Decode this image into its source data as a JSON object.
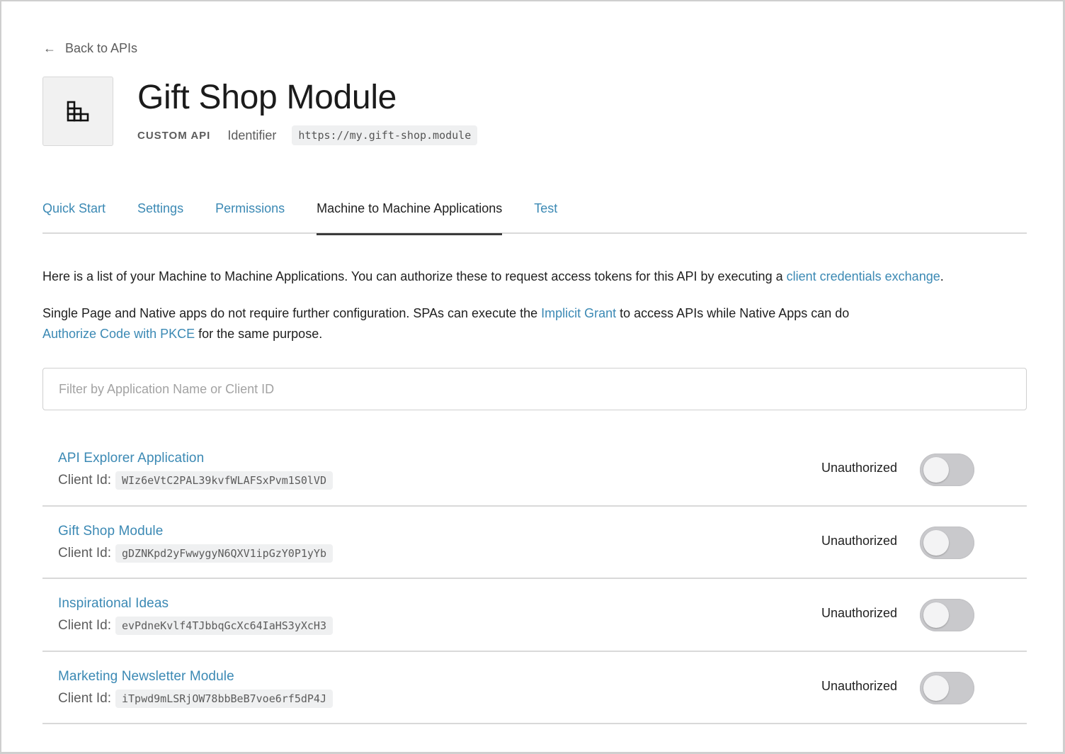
{
  "nav": {
    "back_label": "Back to APIs",
    "back_icon": "arrow-left-icon"
  },
  "header": {
    "logo_icon": "api-blocks-icon",
    "title": "Gift Shop Module",
    "type_label": "CUSTOM API",
    "identifier_label": "Identifier",
    "identifier_value": "https://my.gift-shop.module"
  },
  "tabs": [
    {
      "label": "Quick Start",
      "active": false
    },
    {
      "label": "Settings",
      "active": false
    },
    {
      "label": "Permissions",
      "active": false
    },
    {
      "label": "Machine to Machine Applications",
      "active": true
    },
    {
      "label": "Test",
      "active": false
    }
  ],
  "description": {
    "p1_text": "Here is a list of your Machine to Machine Applications. You can authorize these to request access tokens for this API by executing a ",
    "p1_link": "client credentials exchange",
    "p1_end": ".",
    "p2_text": "Single Page and Native apps do not require further configuration. SPAs can execute the ",
    "p2_link1": "Implicit Grant",
    "p2_mid": " to access APIs while Native Apps can do ",
    "p2_link2": "Authorize Code with PKCE",
    "p2_end": " for the same purpose."
  },
  "filter": {
    "placeholder": "Filter by Application Name or Client ID",
    "value": ""
  },
  "applications": [
    {
      "name": "API Explorer Application",
      "client_label": "Client Id:",
      "client_id": "WIz6eVtC2PAL39kvfWLAFSxPvm1S0lVD",
      "status": "Unauthorized",
      "authorized": false
    },
    {
      "name": "Gift Shop Module",
      "client_label": "Client Id:",
      "client_id": "gDZNKpd2yFwwygyN6QXV1ipGzY0P1yYb",
      "status": "Unauthorized",
      "authorized": false
    },
    {
      "name": "Inspirational Ideas",
      "client_label": "Client Id:",
      "client_id": "evPdneKvlf4TJbbqGcXc64IaHS3yXcH3",
      "status": "Unauthorized",
      "authorized": false
    },
    {
      "name": "Marketing Newsletter Module",
      "client_label": "Client Id:",
      "client_id": "iTpwd9mLSRjOW78bbBeB7voe6rf5dP4J",
      "status": "Unauthorized",
      "authorized": false
    }
  ],
  "colors": {
    "link": "#3b89b4",
    "text": "#1f1f1f",
    "muted": "#5c5c5c",
    "toggle_off": "#c9c9cc"
  }
}
